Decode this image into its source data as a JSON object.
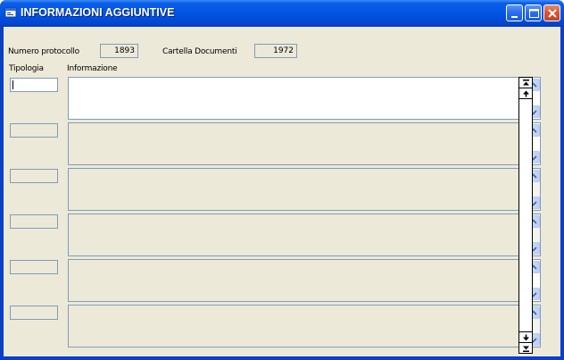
{
  "window": {
    "title": "INFORMAZIONI AGGIUNTIVE",
    "icons": {
      "app": "app-window-icon",
      "minimize": "minimize-icon",
      "maximize": "maximize-icon",
      "close": "close-icon"
    },
    "colors": {
      "titlebar": "#0255e2",
      "client_background": "#ece9d8",
      "field_border": "#7f9db9",
      "close_button": "#d8573a"
    }
  },
  "header": {
    "protocol_label": "Numero protocollo",
    "protocol_value": "1893",
    "folder_label": "Cartella Documenti",
    "folder_value": "1972"
  },
  "columns": {
    "type_label": "Tipologia",
    "info_label": "Informazione"
  },
  "rows": [
    {
      "tipologia": "",
      "informazione": "",
      "active": true
    },
    {
      "tipologia": "",
      "informazione": "",
      "active": false
    },
    {
      "tipologia": "",
      "informazione": "",
      "active": false
    },
    {
      "tipologia": "",
      "informazione": "",
      "active": false
    },
    {
      "tipologia": "",
      "informazione": "",
      "active": false
    },
    {
      "tipologia": "",
      "informazione": "",
      "active": false
    }
  ],
  "navigator": {
    "icons": [
      "first-record-icon",
      "previous-record-icon",
      "next-record-icon",
      "last-record-icon"
    ]
  }
}
